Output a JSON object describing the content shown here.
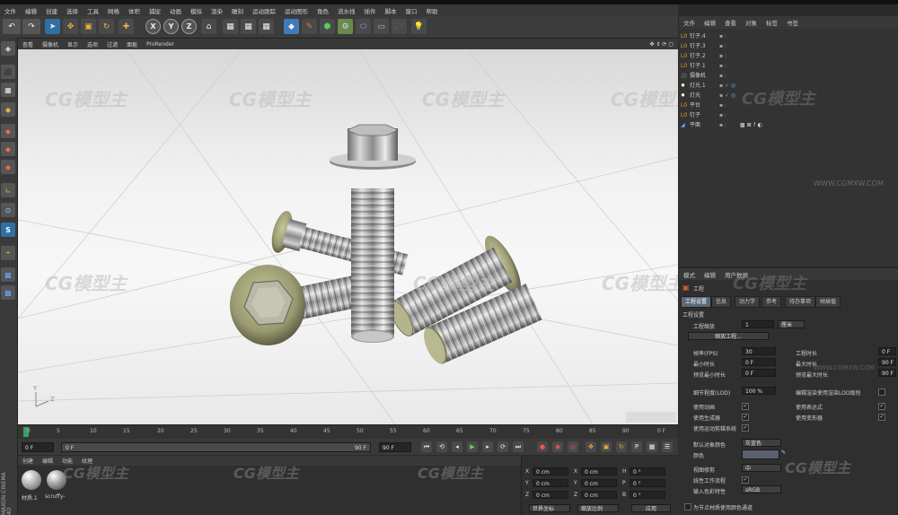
{
  "menubar": [
    "文件",
    "编辑",
    "创建",
    "选择",
    "工具",
    "网格",
    "体积",
    "捕捉",
    "动画",
    "模拟",
    "渲染",
    "雕刻",
    "运动跟踪",
    "运动图形",
    "角色",
    "流水线",
    "插件",
    "脚本",
    "窗口",
    "帮助"
  ],
  "toolbar_axes": [
    "X",
    "Y",
    "Z"
  ],
  "viewport": {
    "menu": [
      "查看",
      "摄像机",
      "显示",
      "选项",
      "过滤",
      "面板",
      "ProRender"
    ],
    "watermark_text": "CG模型主",
    "watermark_url": "WWW.CGMXW.COM",
    "axis_labels": {
      "y": "Y",
      "z": "Z"
    }
  },
  "timeline": {
    "ticks": [
      "0",
      "5",
      "10",
      "15",
      "20",
      "25",
      "30",
      "35",
      "40",
      "45",
      "50",
      "55",
      "60",
      "65",
      "70",
      "75",
      "80",
      "85",
      "90"
    ],
    "current_frame_label": "0 F",
    "start_field": "0 F",
    "end_field": "90 F",
    "end_field2": "90 F",
    "range_right_label": "90 F",
    "range_left_label": "0 F",
    "indicator": "0 F"
  },
  "material_panel": {
    "menu": [
      "创建",
      "编辑",
      "功能",
      "纹理"
    ],
    "materials": [
      {
        "name": "材质.1"
      },
      {
        "name": "scruffy-"
      }
    ]
  },
  "coord_panel": {
    "rows": [
      {
        "a": "X",
        "av": "0 cm",
        "b": "X",
        "bv": "0 cm",
        "c": "H",
        "cv": "0 °"
      },
      {
        "a": "Y",
        "av": "0 cm",
        "b": "Y",
        "bv": "0 cm",
        "c": "P",
        "cv": "0 °"
      },
      {
        "a": "Z",
        "av": "0 cm",
        "b": "Z",
        "bv": "0 cm",
        "c": "B",
        "cv": "0 °"
      }
    ],
    "mode": "世界坐标",
    "scale": "缩放比例",
    "apply": "应用"
  },
  "object_manager": {
    "menu": [
      "文件",
      "编辑",
      "查看",
      "对象",
      "标签",
      "书签"
    ],
    "objects": [
      {
        "name": "钉子.4"
      },
      {
        "name": "钉子.3"
      },
      {
        "name": "钉子.2"
      },
      {
        "name": "钉子.1"
      },
      {
        "name": "摄像机"
      },
      {
        "name": "灯光.1"
      },
      {
        "name": "灯光"
      },
      {
        "name": "平台"
      },
      {
        "name": "钉子"
      },
      {
        "name": "平面"
      }
    ]
  },
  "attributes": {
    "menu": [
      "模式",
      "编辑",
      "用户数据"
    ],
    "title": "工程",
    "tabs": [
      "工程设置",
      "信息",
      "动力学",
      "参考",
      "待办事项",
      "帧插值"
    ],
    "section": "工程设置",
    "scale_label": "工程缩放",
    "scale_value": "1",
    "scale_unit": "厘米",
    "scale_button": "缩放工程...",
    "fps_label": "帧率(FPS)",
    "fps_value": "30",
    "duration_label": "工程时长",
    "duration_value": "0 F",
    "min_label": "最小时长",
    "min_value": "0 F",
    "max_label": "最大时长",
    "max_value": "90 F",
    "pmin_label": "预览最小时长",
    "pmin_value": "0 F",
    "pmax_label": "预览最大时长",
    "pmax_value": "90 F",
    "lod_label": "细节程度(LOD)",
    "lod_value": "100 %",
    "lod_check_label": "编辑渲染使用渲染LOD级别",
    "checks": [
      {
        "label": "使用动画",
        "label2": "使用表达式"
      },
      {
        "label": "使用生成器",
        "label2": "使用变形器"
      },
      {
        "label": "使用运动剪辑系统",
        "label2": ""
      }
    ],
    "default_color_label": "默认对象颜色",
    "default_color_value": "灰蓝色",
    "color_label": "颜色",
    "view_clip_label": "视图修剪",
    "view_clip_value": "中",
    "linear_label": "线性工作流程",
    "input_color_label": "输入色彩特性",
    "input_color_value": "sRGB",
    "bottom_label": "为节点材质使用颜色通道"
  }
}
